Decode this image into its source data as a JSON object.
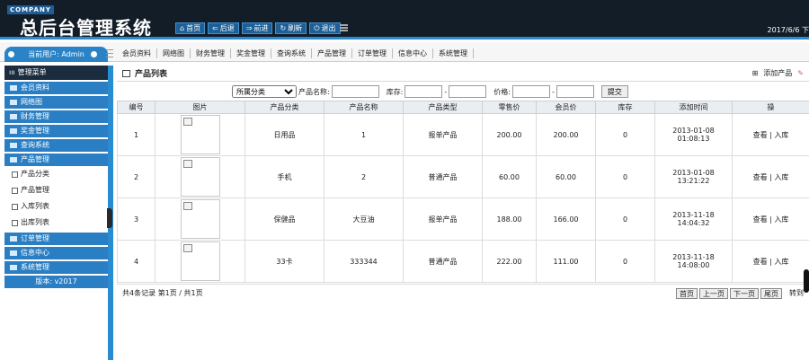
{
  "header": {
    "company": "COMPANY",
    "logo": "总后台管理系统",
    "date": "2017/6/6 下",
    "nav": [
      {
        "icon": "⌂",
        "label": "首页"
      },
      {
        "icon": "⇐",
        "label": "后退"
      },
      {
        "icon": "⇒",
        "label": "前进"
      },
      {
        "icon": "↻",
        "label": "刷新"
      },
      {
        "icon": "⏻",
        "label": "退出"
      }
    ]
  },
  "user": {
    "label": "当前用户: Admin"
  },
  "modules": [
    "会员资料",
    "网络图",
    "财务管理",
    "奖金管理",
    "查询系统",
    "产品管理",
    "订单管理",
    "信息中心",
    "系统管理"
  ],
  "sidebar": {
    "title": "管理菜单",
    "items_top": [
      "会员资料",
      "网络图",
      "财务管理",
      "奖金管理",
      "查询系统",
      "产品管理"
    ],
    "sub_items": [
      "产品分类",
      "产品管理",
      "入库列表",
      "出库列表"
    ],
    "items_bottom": [
      "订单管理",
      "信息中心",
      "系统管理"
    ],
    "version": "版本: v2017"
  },
  "main": {
    "title": "产品列表",
    "add_label": "添加产品",
    "filters": {
      "category": "所属分类",
      "name_label": "产品名称:",
      "stock_label": "库存:",
      "price_label": "价格:",
      "submit": "提交"
    },
    "columns": [
      "编号",
      "图片",
      "产品分类",
      "产品名称",
      "产品类型",
      "零售价",
      "会员价",
      "库存",
      "添加时间",
      "操"
    ],
    "rows": [
      {
        "id": "1",
        "category": "日用品",
        "name": "1",
        "type": "报单产品",
        "retail": "200.00",
        "member": "200.00",
        "stock": "0",
        "time": "2013-01-08 01:08:13",
        "actions": "查看 | 入库"
      },
      {
        "id": "2",
        "category": "手机",
        "name": "2",
        "type": "普通产品",
        "retail": "60.00",
        "member": "60.00",
        "stock": "0",
        "time": "2013-01-08 13:21:22",
        "actions": "查看 | 入库"
      },
      {
        "id": "3",
        "category": "保健品",
        "name": "大豆油",
        "type": "报单产品",
        "retail": "188.00",
        "member": "166.00",
        "stock": "0",
        "time": "2013-11-18 14:04:32",
        "actions": "查看 | 入库"
      },
      {
        "id": "4",
        "category": "33卡",
        "name": "333344",
        "type": "普通产品",
        "retail": "222.00",
        "member": "111.00",
        "stock": "0",
        "time": "2013-11-18 14:08:00",
        "actions": "查看 | 入库"
      }
    ],
    "pager": {
      "summary": "共4条记录  第1页 / 共1页",
      "first": "首页",
      "prev": "上一页",
      "next": "下一页",
      "last": "尾页",
      "goto": "转到"
    }
  },
  "colors": {
    "header_bg": "#121d28",
    "accent": "#2a8cd0",
    "sidebar_item": "#2a7fc4"
  }
}
